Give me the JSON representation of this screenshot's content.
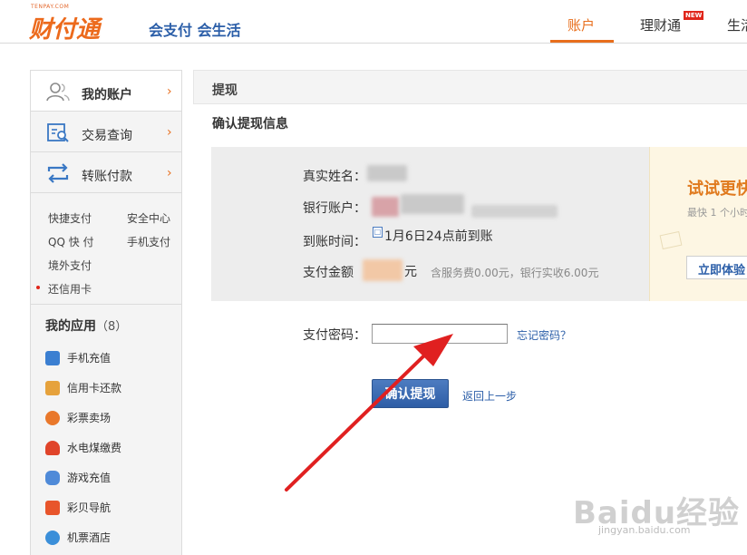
{
  "header": {
    "logo_small": "TENPAY.COM",
    "logo": "财付通",
    "slogan": "会支付 会生活",
    "nav": [
      {
        "label": "账户",
        "active": true
      },
      {
        "label": "理财通",
        "badge": "NEW"
      },
      {
        "label": "生活"
      }
    ]
  },
  "sidebar": {
    "main": [
      {
        "label": "我的账户",
        "icon": "user-icon",
        "active": true
      },
      {
        "label": "交易查询",
        "icon": "search-record-icon"
      },
      {
        "label": "转账付款",
        "icon": "transfer-icon"
      }
    ],
    "sub": [
      "快捷支付",
      "安全中心",
      "QQ 快 付",
      "手机支付",
      "境外支付",
      "还信用卡"
    ],
    "apps_title": "我的应用",
    "apps_count": "（8）",
    "apps": [
      {
        "label": "手机充值",
        "icon": "phone-icon",
        "color": "#3b7fd1"
      },
      {
        "label": "信用卡还款",
        "icon": "card-icon",
        "color": "#e6a23c"
      },
      {
        "label": "彩票卖场",
        "icon": "lottery-icon",
        "color": "#e9782b"
      },
      {
        "label": "水电煤缴费",
        "icon": "flame-icon",
        "color": "#e0442a"
      },
      {
        "label": "游戏充值",
        "icon": "gamepad-icon",
        "color": "#4f8ad8"
      },
      {
        "label": "彩贝导航",
        "icon": "shell-icon",
        "color": "#e8552b"
      },
      {
        "label": "机票酒店",
        "icon": "plane-icon",
        "color": "#3b8fd9"
      }
    ]
  },
  "panel": {
    "title": "提现",
    "section_title": "确认提现信息"
  },
  "info": {
    "name_label": "真实姓名：",
    "account_label": "银行账户：",
    "arrival_label": "到账时间：",
    "arrival_value": "1月6日24点前到账",
    "amount_label": "支付金额",
    "amount_unit": "元",
    "fee_text": "含服务费0.00元，银行实收6.00元"
  },
  "promo": {
    "title": "试试更快",
    "subtitle": "最快 1 个小时",
    "button": "立即体验"
  },
  "form": {
    "password_label": "支付密码：",
    "password_value": "",
    "forgot_label": "忘记密码？",
    "confirm_label": "确认提现",
    "back_label": "返回上一步"
  },
  "watermark": {
    "main": "Baidu经验",
    "sub": "jingyan.baidu.com"
  },
  "colors": {
    "accent": "#e86e1c",
    "link": "#2b5ea8",
    "arrow": "#e02020"
  }
}
